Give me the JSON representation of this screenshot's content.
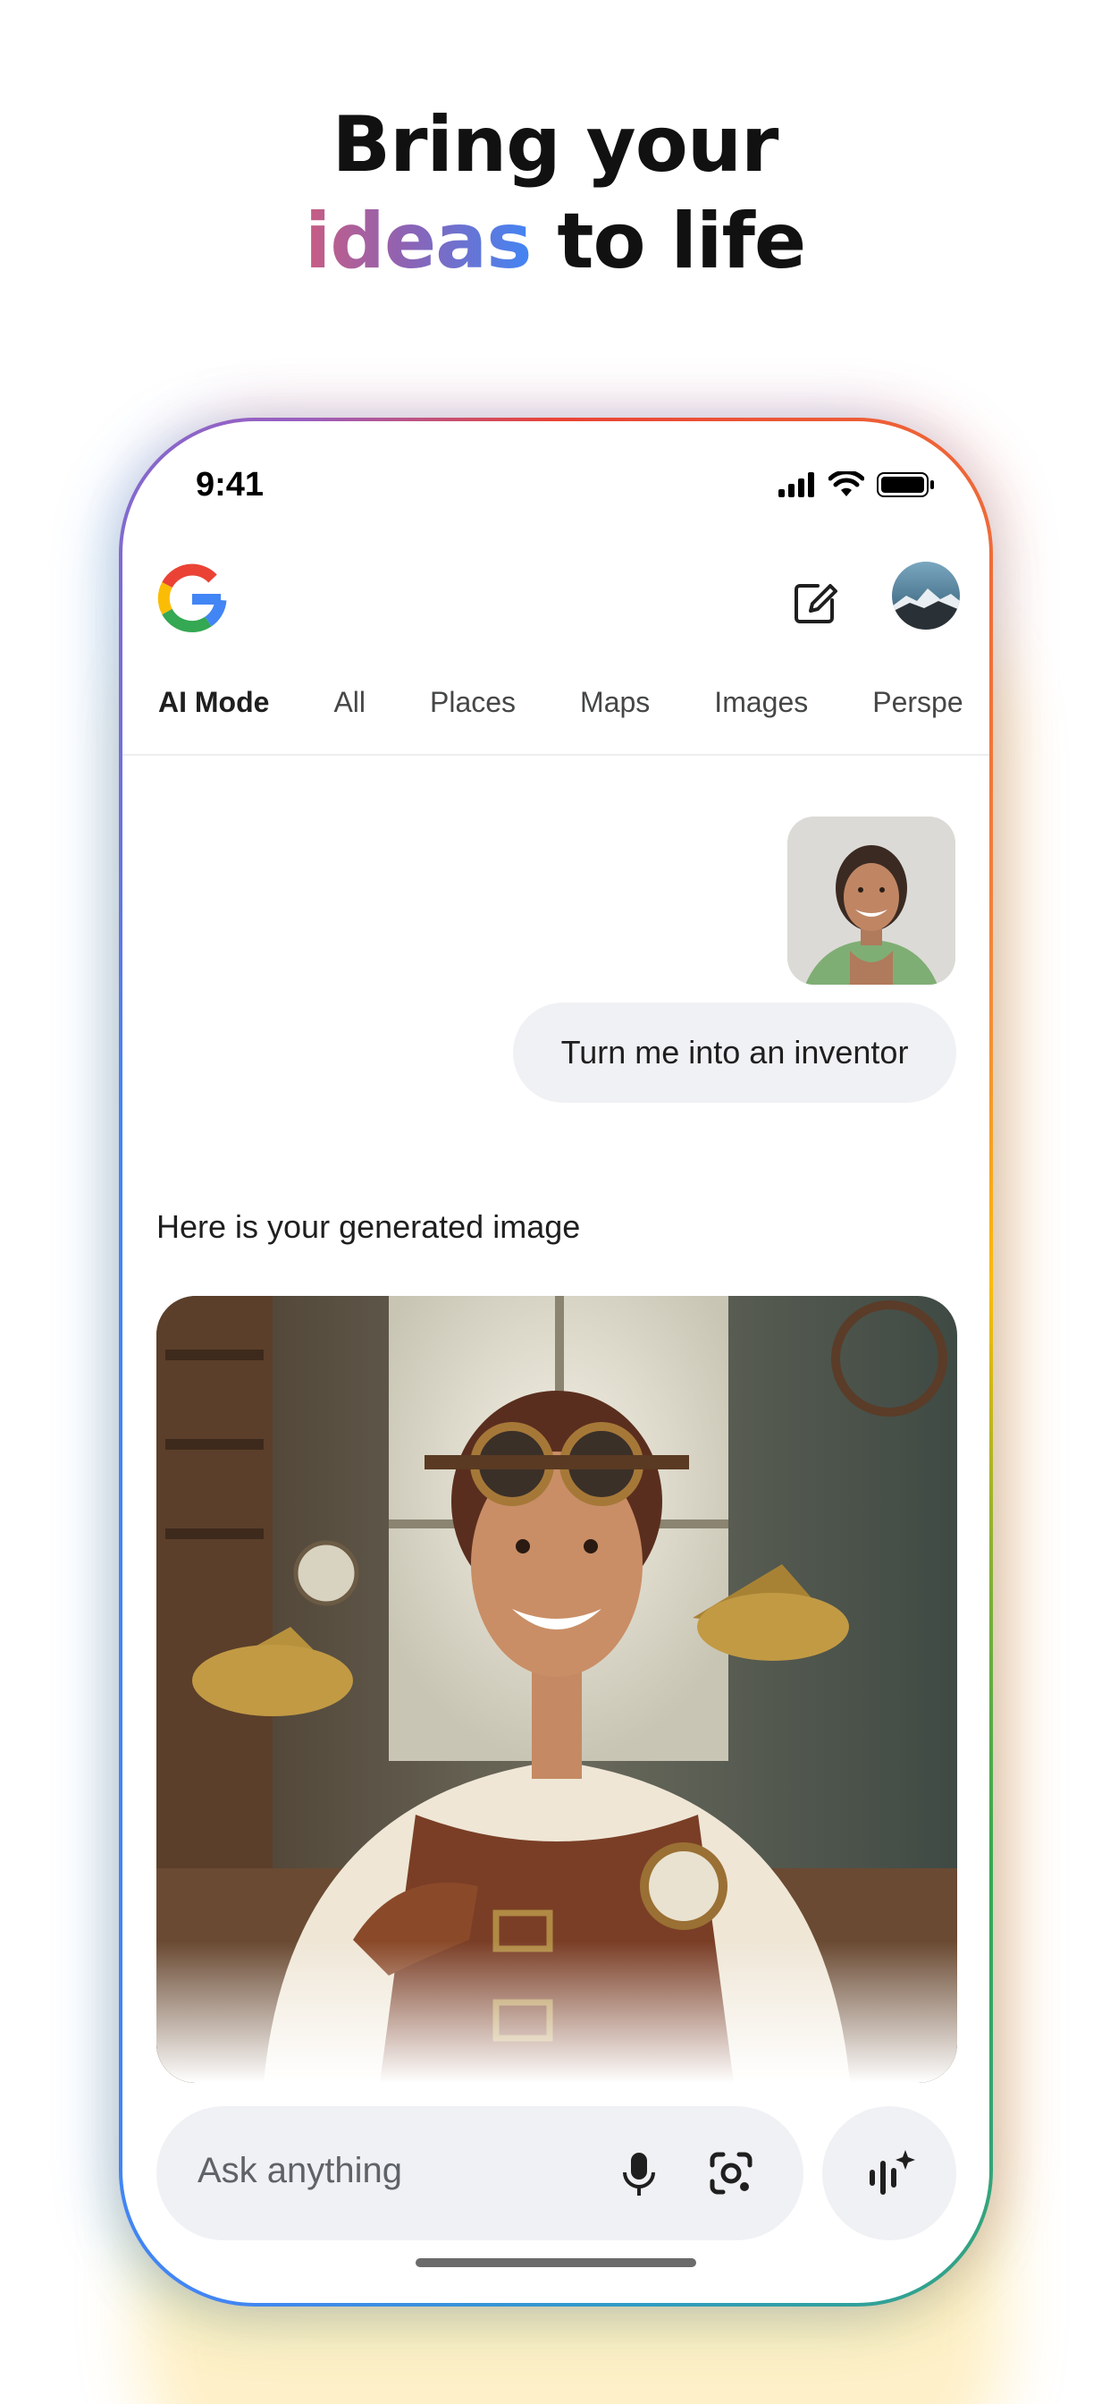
{
  "headline": {
    "line1": "Bring your",
    "highlight": "ideas",
    "line2_rest": " to life"
  },
  "status_bar": {
    "time": "9:41"
  },
  "tabs": [
    "AI Mode",
    "All",
    "Places",
    "Maps",
    "Images",
    "Perspe"
  ],
  "conversation": {
    "user_message": "Turn me into an inventor",
    "assistant_text": "Here is your generated image"
  },
  "input": {
    "placeholder": "Ask anything"
  },
  "icons": [
    "google-g-icon",
    "edit-icon",
    "signal-icon",
    "wifi-icon",
    "battery-icon",
    "mic-icon",
    "lens-icon",
    "voice-sparkle-icon"
  ],
  "colors": {
    "google_blue": "#4285f4",
    "google_red": "#ea4335",
    "google_yellow": "#fbbc05",
    "google_green": "#34a853",
    "highlight_start": "#c95d83",
    "highlight_end": "#4285f4",
    "bubble_bg": "#f0f1f4"
  }
}
